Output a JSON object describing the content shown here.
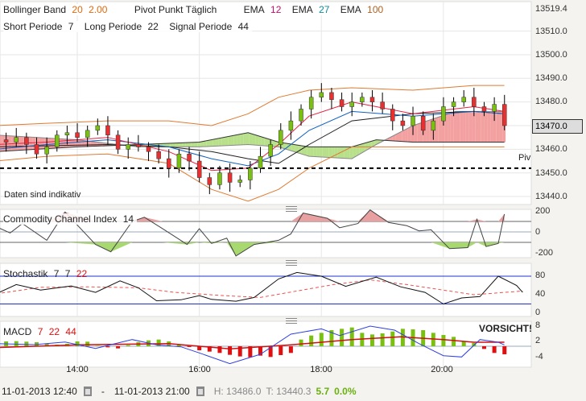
{
  "legend": {
    "bollinger": {
      "label": "Bollinger Band",
      "p1": "20",
      "p2": "2.00"
    },
    "pivot": "Pivot Punkt  Täglich",
    "ema": [
      {
        "label": "EMA",
        "value": "12"
      },
      {
        "label": "EMA",
        "value": "27"
      },
      {
        "label": "EMA",
        "value": "100"
      }
    ],
    "short": {
      "label": "Short Periode",
      "value": "7"
    },
    "long": {
      "label": "Long Periode",
      "value": "22"
    },
    "signal": {
      "label": "Signal Periode",
      "value": "44"
    }
  },
  "disclaimer": "Daten sind indikativ",
  "pivot_label": "Piv",
  "current_price": "13470.0",
  "price_axis": [
    "13519.4",
    "13510.0",
    "13500.0",
    "13490.0",
    "13480.0",
    "13460.0",
    "13450.0",
    "13440.0"
  ],
  "time_axis": [
    "14:00",
    "16:00",
    "18:00",
    "20:00"
  ],
  "cci": {
    "title": "Commodity Channel Index",
    "period": "14",
    "axis": [
      "200",
      "0",
      "-200"
    ]
  },
  "stoch": {
    "title": "Stochastik",
    "p1": "7",
    "p2": "7",
    "p3": "22",
    "axis": [
      "80",
      "40",
      "0"
    ]
  },
  "macd": {
    "title": "MACD",
    "p1": "7",
    "p2": "22",
    "p3": "44",
    "axis": [
      "8",
      "2",
      "-4"
    ],
    "warning": "VORSICHT!"
  },
  "footer": {
    "from": "11-01-2013 12:40",
    "sep": "-",
    "to": "11-01-2013 21:00",
    "high": "H: 13486.0",
    "low": "T: 13440.3",
    "change": "5.7",
    "change_pct": "0.0%"
  },
  "colors": {
    "up": "#7ac010",
    "down": "#e83030",
    "boll": "#e07a30",
    "ema12": "#e82040",
    "ema27": "#1060c0",
    "ema100": "#202020"
  },
  "chart_data": {
    "type": "candlestick",
    "start_hour": 12.667,
    "step_hours": 0.1667,
    "close": [
      13464,
      13463,
      13465,
      13462,
      13458,
      13461,
      13466,
      13467,
      13465,
      13468,
      13470,
      13466,
      13460,
      13462,
      13461,
      13459,
      13456,
      13452,
      13458,
      13455,
      13448,
      13445,
      13450,
      13446,
      13447,
      13452,
      13457,
      13462,
      13468,
      13472,
      13477,
      13482,
      13484,
      13481,
      13478,
      13480,
      13482,
      13480,
      13477,
      13472,
      13470,
      13474,
      13468,
      13472,
      13478,
      13480,
      13482,
      13478,
      13476,
      13479,
      13470
    ],
    "boll_upper": [
      [
        12.67,
        13470
      ],
      [
        13.5,
        13471
      ],
      [
        14.5,
        13472
      ],
      [
        15.5,
        13472
      ],
      [
        16.2,
        13470
      ],
      [
        16.8,
        13475
      ],
      [
        17.3,
        13482
      ],
      [
        17.8,
        13485
      ],
      [
        18.5,
        13486
      ],
      [
        19.5,
        13485
      ],
      [
        20.5,
        13487
      ],
      [
        21,
        13487
      ]
    ],
    "boll_lower": [
      [
        12.67,
        13455
      ],
      [
        13.5,
        13457
      ],
      [
        14.5,
        13458
      ],
      [
        15.5,
        13454
      ],
      [
        16.2,
        13443
      ],
      [
        16.8,
        13438
      ],
      [
        17.3,
        13443
      ],
      [
        17.8,
        13452
      ],
      [
        18.5,
        13461
      ],
      [
        19.5,
        13461
      ],
      [
        20.5,
        13461
      ],
      [
        21,
        13461
      ]
    ],
    "ema12": [
      [
        12.67,
        13462
      ],
      [
        13.5,
        13463
      ],
      [
        14.5,
        13465
      ],
      [
        15.5,
        13459
      ],
      [
        16.2,
        13451
      ],
      [
        16.8,
        13452
      ],
      [
        17.3,
        13462
      ],
      [
        17.8,
        13474
      ],
      [
        18.5,
        13480
      ],
      [
        19.5,
        13475
      ],
      [
        20.5,
        13478
      ],
      [
        21,
        13476
      ]
    ],
    "ema27": [
      [
        12.67,
        13460
      ],
      [
        13.5,
        13462
      ],
      [
        14.5,
        13464
      ],
      [
        15.5,
        13461
      ],
      [
        16.2,
        13456
      ],
      [
        16.8,
        13453
      ],
      [
        17.3,
        13458
      ],
      [
        17.8,
        13468
      ],
      [
        18.5,
        13476
      ],
      [
        19.5,
        13474
      ],
      [
        20.5,
        13476
      ],
      [
        21,
        13475
      ]
    ],
    "ema100": [
      [
        12.67,
        13461
      ],
      [
        14.5,
        13462
      ],
      [
        15.5,
        13461
      ],
      [
        16.2,
        13459
      ],
      [
        16.8,
        13456
      ],
      [
        17.3,
        13454
      ],
      [
        17.8,
        13462
      ],
      [
        18.5,
        13472
      ],
      [
        19.5,
        13475
      ],
      [
        20.5,
        13476
      ],
      [
        21,
        13475
      ]
    ],
    "cloud_a": [
      [
        12.67,
        13466
      ],
      [
        14.0,
        13464
      ],
      [
        15.0,
        13461
      ],
      [
        16.0,
        13461
      ],
      [
        16.8,
        13462
      ],
      [
        17.3,
        13461
      ],
      [
        17.8,
        13457
      ],
      [
        18.5,
        13456
      ],
      [
        18.9,
        13462
      ],
      [
        19.5,
        13470
      ],
      [
        20.2,
        13476
      ],
      [
        21,
        13476
      ]
    ],
    "cloud_b": [
      [
        12.67,
        13459
      ],
      [
        14.0,
        13461
      ],
      [
        15.0,
        13462
      ],
      [
        16.0,
        13463
      ],
      [
        16.8,
        13467
      ],
      [
        17.3,
        13463
      ],
      [
        17.8,
        13461
      ],
      [
        18.5,
        13461
      ],
      [
        18.9,
        13464
      ],
      [
        19.5,
        13463
      ],
      [
        20.2,
        13463
      ],
      [
        21,
        13463
      ]
    ],
    "pivot": 13452,
    "cci": [
      [
        12.67,
        50
      ],
      [
        12.9,
        -10
      ],
      [
        13.1,
        80
      ],
      [
        13.5,
        -80
      ],
      [
        13.8,
        190
      ],
      [
        14.3,
        -120
      ],
      [
        14.55,
        -190
      ],
      [
        14.9,
        100
      ],
      [
        15.1,
        140
      ],
      [
        15.4,
        30
      ],
      [
        15.8,
        -120
      ],
      [
        16.0,
        30
      ],
      [
        16.2,
        -110
      ],
      [
        16.45,
        -60
      ],
      [
        16.6,
        -230
      ],
      [
        16.9,
        -120
      ],
      [
        17.3,
        -80
      ],
      [
        17.5,
        -20
      ],
      [
        17.7,
        180
      ],
      [
        18.1,
        130
      ],
      [
        18.3,
        40
      ],
      [
        18.6,
        80
      ],
      [
        18.8,
        210
      ],
      [
        19.1,
        90
      ],
      [
        19.4,
        60
      ],
      [
        19.6,
        10
      ],
      [
        19.8,
        20
      ],
      [
        20.1,
        -160
      ],
      [
        20.4,
        -150
      ],
      [
        20.55,
        120
      ],
      [
        20.7,
        -140
      ],
      [
        20.9,
        -110
      ],
      [
        21.0,
        170
      ]
    ],
    "stoch_k": [
      [
        12.67,
        42
      ],
      [
        13.0,
        62
      ],
      [
        13.4,
        50
      ],
      [
        13.9,
        59
      ],
      [
        14.3,
        45
      ],
      [
        14.7,
        70
      ],
      [
        15.0,
        55
      ],
      [
        15.3,
        27
      ],
      [
        15.7,
        29
      ],
      [
        16.0,
        38
      ],
      [
        16.2,
        30
      ],
      [
        16.6,
        26
      ],
      [
        16.9,
        34
      ],
      [
        17.3,
        74
      ],
      [
        17.6,
        88
      ],
      [
        18.0,
        80
      ],
      [
        18.4,
        58
      ],
      [
        18.9,
        78
      ],
      [
        19.3,
        57
      ],
      [
        19.7,
        45
      ],
      [
        20.0,
        20
      ],
      [
        20.3,
        33
      ],
      [
        20.6,
        36
      ],
      [
        20.9,
        80
      ],
      [
        21.2,
        60
      ],
      [
        21.3,
        45
      ]
    ],
    "stoch_d": [
      [
        12.67,
        42
      ],
      [
        13.4,
        56
      ],
      [
        14.2,
        57
      ],
      [
        15.0,
        55
      ],
      [
        15.6,
        45
      ],
      [
        16.4,
        38
      ],
      [
        17.0,
        34
      ],
      [
        17.6,
        48
      ],
      [
        18.2,
        62
      ],
      [
        18.8,
        72
      ],
      [
        19.4,
        62
      ],
      [
        20.0,
        50
      ],
      [
        20.5,
        40
      ],
      [
        21.3,
        48
      ]
    ],
    "macd_hist": [
      2.1,
      1.8,
      1.9,
      1.7,
      1.5,
      1.0,
      0.6,
      0.9,
      1.8,
      1.7,
      0.2,
      -0.4,
      -0.8,
      0.4,
      1.5,
      2.2,
      2.5,
      1.8,
      0.6,
      -0.3,
      -1.5,
      -2.0,
      -2.5,
      -3.2,
      -3.8,
      -4.1,
      -3.5,
      -4.0,
      -3.3,
      -2.5,
      2.5,
      4.0,
      5.0,
      6.0,
      6.5,
      7.0,
      5.0,
      4.4,
      4.8,
      5.5,
      6.5,
      6.3,
      6.0,
      5.0,
      4.2,
      3.5,
      1.8,
      1.2,
      -1.0,
      -2.5,
      -3.0
    ],
    "macd_line": [
      [
        12.67,
        1.0
      ],
      [
        13.3,
        0.6
      ],
      [
        13.8,
        1.6
      ],
      [
        14.3,
        -0.8
      ],
      [
        14.9,
        2.5
      ],
      [
        15.3,
        0.5
      ],
      [
        15.7,
        -0.2
      ],
      [
        16.0,
        -2.5
      ],
      [
        16.5,
        -6.5
      ],
      [
        17.0,
        -3.0
      ],
      [
        17.5,
        4.5
      ],
      [
        18.0,
        6.5
      ],
      [
        18.3,
        4.0
      ],
      [
        18.8,
        7.5
      ],
      [
        19.2,
        6.0
      ],
      [
        19.6,
        1.0
      ],
      [
        20.0,
        -3.5
      ],
      [
        20.3,
        -4.0
      ],
      [
        20.6,
        2.5
      ],
      [
        20.9,
        1.5
      ],
      [
        21.0,
        0.5
      ]
    ],
    "macd_signal": [
      [
        12.67,
        -0.5
      ],
      [
        14.0,
        0.5
      ],
      [
        15.5,
        1.0
      ],
      [
        16.5,
        -1.0
      ],
      [
        17.5,
        0.5
      ],
      [
        18.5,
        2.5
      ],
      [
        19.3,
        3.5
      ],
      [
        20.0,
        2.5
      ],
      [
        20.5,
        1.5
      ],
      [
        21.0,
        1.5
      ]
    ]
  }
}
